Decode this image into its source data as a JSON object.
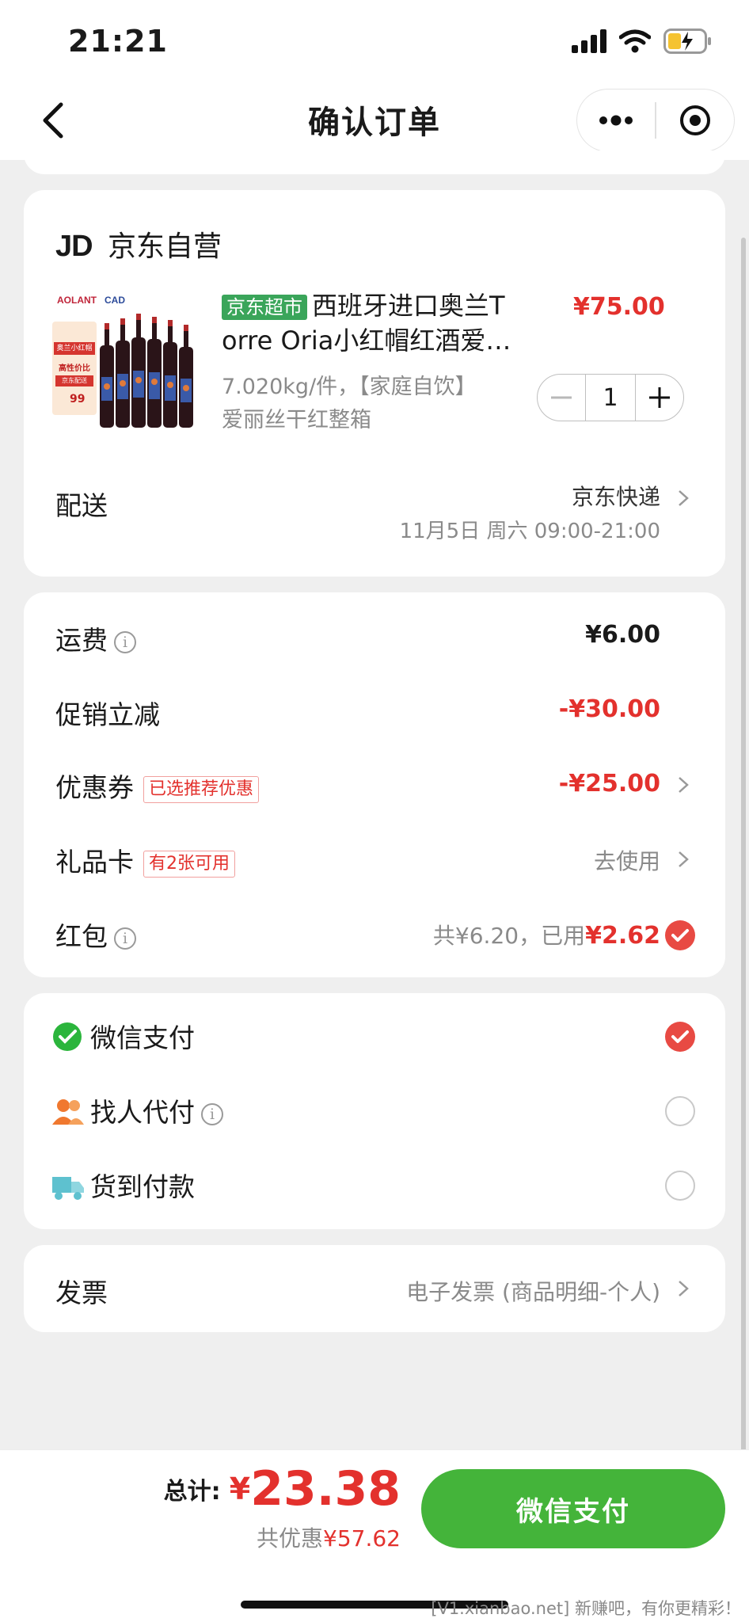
{
  "status_bar": {
    "time": "21:21"
  },
  "nav": {
    "title": "确认订单"
  },
  "store": {
    "logo": "JD",
    "name": "京东自营"
  },
  "product": {
    "tag": "京东超市",
    "title_line1": "西班牙进口奥兰T",
    "title_line2": "orre Oria小红帽红酒爱…",
    "price": "¥75.00",
    "spec_line1": "7.020kg/件，【家庭自饮】",
    "spec_line2": "爱丽丝干红整箱",
    "quantity": "1",
    "image_brand": "AOLANT",
    "image_brand2": "CAD",
    "image_label1": "奥兰小红帽",
    "image_label2": "高性价比",
    "image_label3": "京东配送",
    "image_price": "99"
  },
  "delivery": {
    "label": "配送",
    "method": "京东快递",
    "time": "11月5日 周六 09:00-21:00"
  },
  "fees": {
    "shipping_label": "运费",
    "shipping_value": "¥6.00",
    "promo_label": "促销立减",
    "promo_value": "-¥30.00",
    "coupon_label": "优惠券",
    "coupon_tag": "已选推荐优惠",
    "coupon_value": "-¥25.00",
    "giftcard_label": "礼品卡",
    "giftcard_tag": "有2张可用",
    "giftcard_value": "去使用",
    "redpacket_label": "红包",
    "redpacket_total": "共¥6.20，已用",
    "redpacket_used": "¥2.62"
  },
  "payment": {
    "options": [
      {
        "label": "微信支付",
        "checked": true
      },
      {
        "label": "找人代付",
        "checked": false
      },
      {
        "label": "货到付款",
        "checked": false
      }
    ]
  },
  "invoice": {
    "label": "发票",
    "value": "电子发票 (商品明细-个人)"
  },
  "bottom": {
    "total_label": "总计:",
    "currency": "¥",
    "total": "23.38",
    "saved_prefix": "共优惠",
    "saved": "¥57.62",
    "pay_button": "微信支付",
    "watermark": "[V1.xianbao.net] 新赚吧，有你更精彩！"
  },
  "colors": {
    "red": "#e3312d",
    "green": "#44b43a",
    "tag_green": "#3aa55a"
  }
}
